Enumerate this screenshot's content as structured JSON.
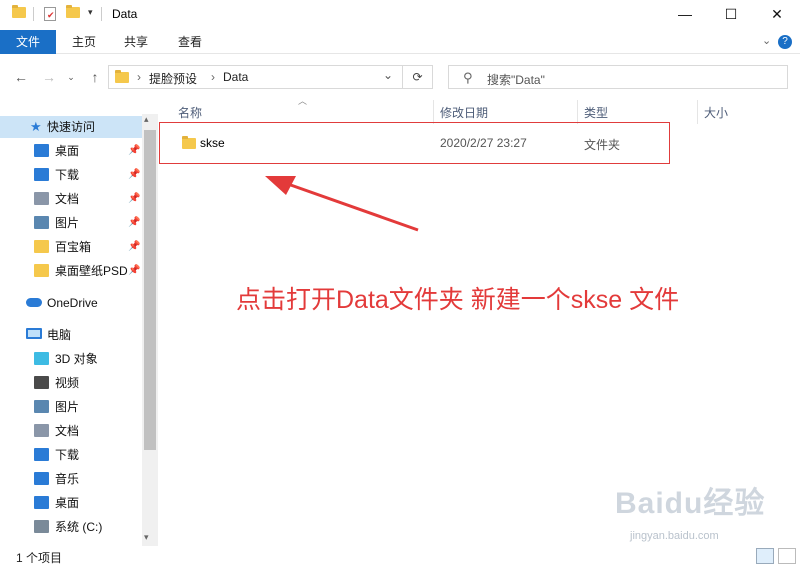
{
  "window": {
    "title": "Data",
    "controls": {
      "minimize": "—",
      "maximize": "☐",
      "close": "✕"
    }
  },
  "ribbon": {
    "tabs": [
      "文件",
      "主页",
      "共享",
      "查看"
    ],
    "active_tab": "文件",
    "chevron": "⌄",
    "help": "?"
  },
  "address": {
    "segments": [
      "提脸预设",
      "Data"
    ],
    "separator": "›",
    "dropdown": "⌄",
    "refresh": "⟳",
    "search_placeholder": "搜索\"Data\""
  },
  "sidebar": {
    "quick_access": "快速访问",
    "pinned": [
      {
        "label": "桌面",
        "icon": "desktop-icon",
        "color": "#2a7bd6"
      },
      {
        "label": "下载",
        "icon": "download-icon",
        "color": "#2a7bd6"
      },
      {
        "label": "文档",
        "icon": "document-icon",
        "color": "#8a96a8"
      },
      {
        "label": "图片",
        "icon": "pictures-icon",
        "color": "#5a87b0"
      },
      {
        "label": "百宝箱",
        "icon": "folder-icon",
        "color": "#f5c84c"
      },
      {
        "label": "桌面壁纸PSD",
        "icon": "folder-icon",
        "color": "#f5c84c"
      }
    ],
    "onedrive": "OneDrive",
    "this_pc": "电脑",
    "pc_items": [
      {
        "label": "3D 对象",
        "icon": "3d-objects-icon",
        "color": "#3dbbe3"
      },
      {
        "label": "视频",
        "icon": "video-icon",
        "color": "#4a4a4a"
      },
      {
        "label": "图片",
        "icon": "pictures-icon",
        "color": "#5a87b0"
      },
      {
        "label": "文档",
        "icon": "document-icon",
        "color": "#8a96a8"
      },
      {
        "label": "下载",
        "icon": "download-icon",
        "color": "#2a7bd6"
      },
      {
        "label": "音乐",
        "icon": "music-icon",
        "color": "#2a7bd6"
      },
      {
        "label": "桌面",
        "icon": "desktop-icon",
        "color": "#2a7bd6"
      },
      {
        "label": "系统 (C:)",
        "icon": "drive-icon",
        "color": "#7a8a99"
      }
    ]
  },
  "columns": [
    "名称",
    "修改日期",
    "类型",
    "大小"
  ],
  "files": [
    {
      "name": "skse",
      "modified": "2020/2/27 23:27",
      "type": "文件夹",
      "size": ""
    }
  ],
  "annotation": "点击打开Data文件夹 新建一个skse 文件",
  "watermark": {
    "brand": "Baidu经验",
    "url": "jingyan.baidu.com"
  },
  "status": {
    "item_count": "1 个项目"
  },
  "colors": {
    "accent": "#1a6fc6",
    "annotation": "#e33a3a",
    "selection": "#cce4f7"
  }
}
